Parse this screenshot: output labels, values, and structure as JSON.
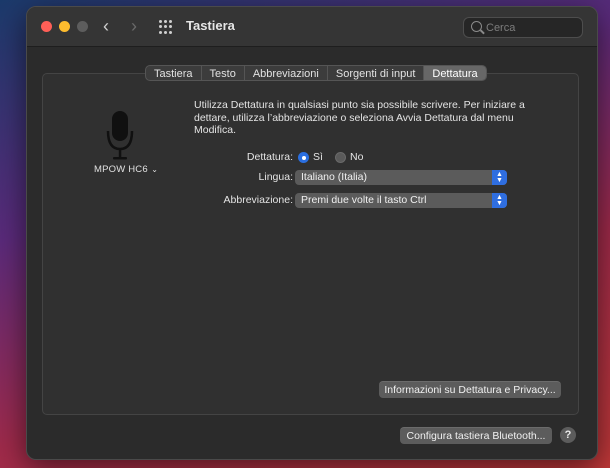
{
  "window": {
    "title": "Tastiera",
    "search": {
      "placeholder": "Cerca",
      "value": ""
    }
  },
  "tabs": [
    {
      "label": "Tastiera"
    },
    {
      "label": "Testo"
    },
    {
      "label": "Abbreviazioni"
    },
    {
      "label": "Sorgenti di input"
    },
    {
      "label": "Dettatura",
      "active": true
    }
  ],
  "microphone": {
    "label": "MPOW HC6",
    "icon": "microphone-icon"
  },
  "description": "Utilizza Dettatura in qualsiasi punto sia possibile scrivere. Per iniziare a dettare, utilizza l’abbreviazione o seleziona Avvia Dettatura dal menu Modifica.",
  "dictation": {
    "label": "Dettatura:",
    "options": {
      "on": "Sì",
      "off": "No"
    },
    "selected": "Sì"
  },
  "language": {
    "label": "Lingua:",
    "value": "Italiano (Italia)"
  },
  "shortcut": {
    "label": "Abbreviazione:",
    "value": "Premi due volte il tasto Ctrl"
  },
  "buttons": {
    "privacy": "Informazioni su Dettatura e Privacy...",
    "bluetooth": "Configura tastiera Bluetooth...",
    "help": "?"
  },
  "colors": {
    "accent": "#2b6fe0",
    "close": "#ff5f57",
    "minimize": "#febc2e"
  }
}
